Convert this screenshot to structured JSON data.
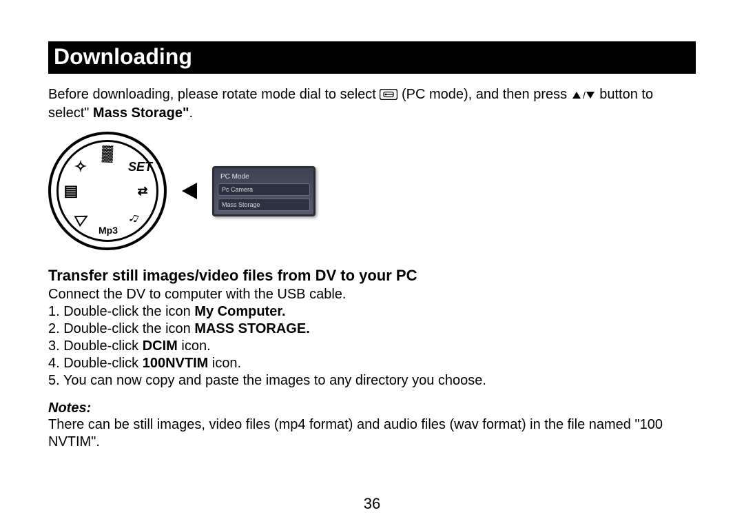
{
  "title": "Downloading",
  "intro": {
    "seg1": "Before downloading, please rotate mode dial to select ",
    "pc_mode_label": "(PC mode), and then press ",
    "seg2": " button to select\" ",
    "mass_storage": "Mass Storage\"",
    "trailing": "."
  },
  "lcd": {
    "title": "PC Mode",
    "row1": "Pc Camera",
    "row2": "Mass Storage"
  },
  "dial_labels": {
    "top": "▓",
    "tl": "✧",
    "tr": "SET",
    "left": "▤",
    "right": "⇄",
    "bl": "▷",
    "br": "♫",
    "bottom": "Mp3"
  },
  "subheading": "Transfer still images/video files from DV to your PC",
  "steps_intro": "Connect the DV to computer with the USB cable.",
  "steps": {
    "s1a": "1. Double-click the icon ",
    "s1b": "My Computer.",
    "s2a": "2. Double-click the icon ",
    "s2b": "MASS STORAGE.",
    "s3a": "3. Double-click ",
    "s3b": "DCIM",
    "s3c": " icon.",
    "s4a": "4. Double-click ",
    "s4b": "100NVTIM",
    "s4c": " icon.",
    "s5": "5. You can now copy and paste the images to any directory you choose."
  },
  "notes_heading": "Notes:",
  "notes_body": "There can be still images, video files (mp4 format) and audio files (wav format) in the file named \"100 NVTIM\".",
  "page_number": "36"
}
